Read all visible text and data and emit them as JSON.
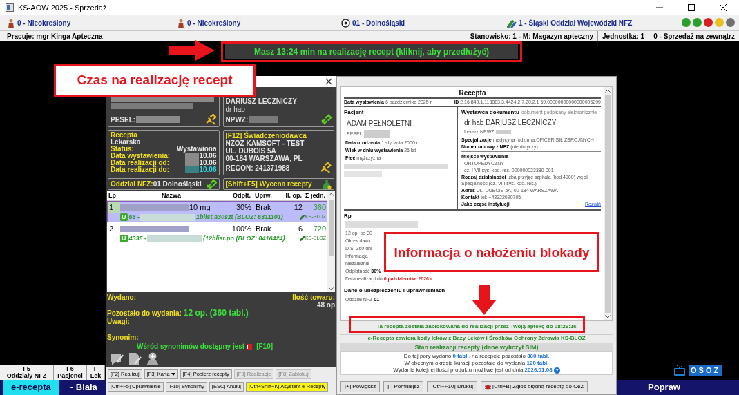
{
  "window": {
    "title": "KS-AOW 2025 - Sprzedaż"
  },
  "info_bar": [
    {
      "kind": "person",
      "label": "0 - Nieokreślony"
    },
    {
      "kind": "person",
      "label": "0 - Nieokreślony"
    },
    {
      "kind": "ball",
      "label": "01 - Dolnośląski"
    },
    {
      "kind": "nfz",
      "label": "1 - Śląski Oddział Wojewódzki NFZ"
    }
  ],
  "status_lights": [
    {
      "color": "#2e9e2e"
    },
    {
      "color": "#2e9e2e"
    },
    {
      "color": "#d42020"
    },
    {
      "color": "#e8c020"
    },
    {
      "color": "#707070"
    }
  ],
  "user_bar": {
    "user": "Pracuje: mgr Kinga Apteczna",
    "station": "Stanowisko: 1 - M: Magazyn apteczny",
    "unit": "Jednostka: 1",
    "sale": "0 - Sprzedaż na zewnątrz"
  },
  "timer": "Masz 13:24 min na realizację recept (kliknij, aby przedłużyć)",
  "annotations": [
    {
      "text": "Czas na realizację recept"
    },
    {
      "text": "Informacja o nałożeniu blokady"
    }
  ],
  "dialog": {
    "patient": {
      "pesel_label": "PESEL:",
      "linked": false
    },
    "doctor": {
      "name": "DARIUSZ LECZNICZY",
      "title": "dr hab",
      "npwz_label": "NPWZ:",
      "linked": true
    },
    "recepta": {
      "title": "Recepta",
      "type": "Lekarska",
      "rows": [
        {
          "label": "Status:",
          "value": "Wystawiona",
          "blurred": false,
          "highlight": false
        },
        {
          "label": "Data wystawienia:",
          "value": "10.06",
          "blurred": true,
          "highlight": false
        },
        {
          "label": "Data realizacji od:",
          "value": "10.06",
          "blurred": true,
          "highlight": false
        },
        {
          "label": "Data realizacji do:",
          "value": "10.06",
          "blurred": true,
          "highlight": true
        }
      ]
    },
    "provider": {
      "title": "[F12] Świadczeniodawca",
      "lines": [
        "NZOZ KAMSOFT - TEST",
        "UL. DUBOIS 5A",
        "00-184 WARSZAWA, PL"
      ],
      "regon": "REGON: 241371988",
      "linked": false
    },
    "branch": {
      "label": "Oddział NFZ:",
      "value": "01 Dolnośląski",
      "linked": true
    },
    "pricing": "[Shift+F5] Wycena recepty",
    "table": {
      "columns": [
        "Lp",
        "Nazwa",
        "Odpłt.",
        "Uprw.",
        "Il. op.",
        "Σ jedn."
      ],
      "rows": [
        {
          "lp": "1",
          "name": "10 mg",
          "payment": "30%",
          "entitlement": "Brak",
          "qty": "12",
          "units": "360",
          "badge": "U",
          "code": "66 -",
          "detail": "1blist.a30szt (BLOZ: 6311101)",
          "source": "KS-BLOZ",
          "selected": true
        },
        {
          "lp": "2",
          "name": "",
          "payment": "100%",
          "entitlement": "Brak",
          "qty": "6",
          "units": "720",
          "badge": "U",
          "code": "4335 -",
          "detail": "(12blist.po (BLOZ: 8416424)",
          "source": "KS-BLOZ",
          "selected": false
        }
      ]
    },
    "issued_label": "Wydano:",
    "stock_label": "Ilość towaru:",
    "stock_value": "48 op",
    "remaining_label": "Pozostało do wydania:",
    "remaining_value": "12 op. (360 tabl.)",
    "notes_label": "Uwagi:",
    "synonym_label": "Synonim:",
    "synonym_text": "Wśród synonimów dostępny jest",
    "synonym_key": "[F10]",
    "buttons": [
      [
        {
          "label": "[F2] Realizuj",
          "disabled": false,
          "dropdown": false,
          "highlight": false
        },
        {
          "label": "[F3] Karta",
          "disabled": false,
          "dropdown": true,
          "highlight": false
        },
        {
          "label": "[F4] Pobierz recepty",
          "disabled": false,
          "dropdown": false,
          "highlight": false
        },
        {
          "label": "[F9] Realizacje",
          "disabled": true,
          "dropdown": false,
          "highlight": false
        },
        {
          "label": "[F8] Zablokuj",
          "disabled": true,
          "dropdown": false,
          "highlight": false
        }
      ],
      [
        {
          "label": "[Ctrl+F5] Uprawnienie",
          "disabled": false,
          "dropdown": false,
          "highlight": false
        },
        {
          "label": "[F10] Synonimy",
          "disabled": false,
          "dropdown": false,
          "highlight": false
        },
        {
          "label": "[ESC] Anuluj",
          "disabled": false,
          "dropdown": false,
          "highlight": false
        },
        {
          "label": "[Ctrl+Shift+K] Asystent e-Recepty",
          "disabled": false,
          "dropdown": false,
          "highlight": true
        }
      ]
    ]
  },
  "document": {
    "title": "Recepta",
    "issue_label": "Data wystawienia",
    "issue_date": "6 października 2025 r.",
    "id_label": "ID",
    "id": "2.16.840.1.113883.3.4424.2.7.20.2.1 69.00000000000000005299",
    "patient": {
      "heading": "Pacjent",
      "name": "ADAM PEŁNOLETNI",
      "pesel_label": "PESEL",
      "fields": [
        {
          "label": "Data urodzenia",
          "value": "1 stycznia 2000 r."
        },
        {
          "label": "Wiek w dniu wystawienia",
          "value": "25 lat"
        },
        {
          "label": "Płeć",
          "value": "mężczyzna"
        }
      ]
    },
    "issuer": {
      "heading": "Wystawca dokumentu",
      "note": "dokument podpisany elektronicznie",
      "name": "dr hab DARIUSZ LECZNICZY",
      "npwz_label": "Lekarz NPWZ",
      "fields": [
        {
          "label": "Specjalizacje",
          "value": "medycyna rodzinna,OFICER SIŁ ZBROJNYCH"
        },
        {
          "label": "Numer umowy z NFZ",
          "value": "(nie dotyczy)"
        }
      ]
    },
    "place": {
      "heading": "Miejsce wystawienia",
      "name": "ORTOPEDYCZNY",
      "code": "cz. I-VII sys. kod. res. 000000023380-001",
      "fields": [
        {
          "label": "Rodzaj działalności",
          "value": "Izba przyjęć szpitala (kod 4900) wg sł. Specjalność (cz. VIII sys. kod. res.)"
        },
        {
          "label": "Adres",
          "value": "UL. DUBOIS 5A, 00-184 WARSZAWA"
        },
        {
          "label": "Kontakt",
          "value": "tel: +48322090705"
        }
      ],
      "institution": "Jako część instytucji",
      "expand": "Rozwiń"
    },
    "rp": {
      "heading": "Rp",
      "lines": [
        "12 op. po 30",
        "Okres dawk",
        "D.S. 360 dni",
        "Informacja",
        "niezależnie"
      ],
      "payment_label": "Odpłatność",
      "payment": "30%",
      "until_label": "Data realizacji do",
      "until": "6 października 2026 r."
    },
    "insurance": {
      "heading": "Dane o ubezpieczeniu i uprawnieniach",
      "label": "Oddział NFZ",
      "value": "01"
    }
  },
  "block_message": "Ta recepta została zablokowana do realizacji przez Twoją aptekę do 08:29:16",
  "bloz_note": "e-Recepta zawiera kody leków z Bazy Leków i Środków Ochrony Zdrowia KS-BLOZ",
  "status": {
    "heading": "Stan realizacji recepty (dane wyliczył SIM)",
    "lines": [
      "Do tej pory wydano **0 tabl.**, na recepcie pozostało **360 tabl.**",
      "W obecnym okresie kuracji pozostało do wydania **120 tabl.**",
      "Wydanie kolejnej ilości produktu możliwe jest od dnia **2026.01.08**"
    ]
  },
  "doc_buttons": [
    {
      "label": "[+] Powiększ",
      "kind": "plain"
    },
    {
      "label": "[-] Pomniejsz",
      "kind": "plain"
    },
    {
      "label": "[Ctrl+F10] Drukuj",
      "kind": "plain"
    },
    {
      "label": "[Ctrl+B] Zgłoś błędną receptę do CeZ",
      "kind": "bug"
    }
  ],
  "fkeys": [
    {
      "key": "F5",
      "label": "Oddziały NFZ"
    },
    {
      "key": "F6",
      "label": "Pacjenci"
    },
    {
      "key": "F",
      "label": "Lek"
    }
  ],
  "bottom_tabs": [
    {
      "label": "e-recepta",
      "selected": true
    },
    {
      "label": "- Biała",
      "selected": false
    }
  ],
  "bottom_right": "Popraw",
  "logo": "OSOZ"
}
